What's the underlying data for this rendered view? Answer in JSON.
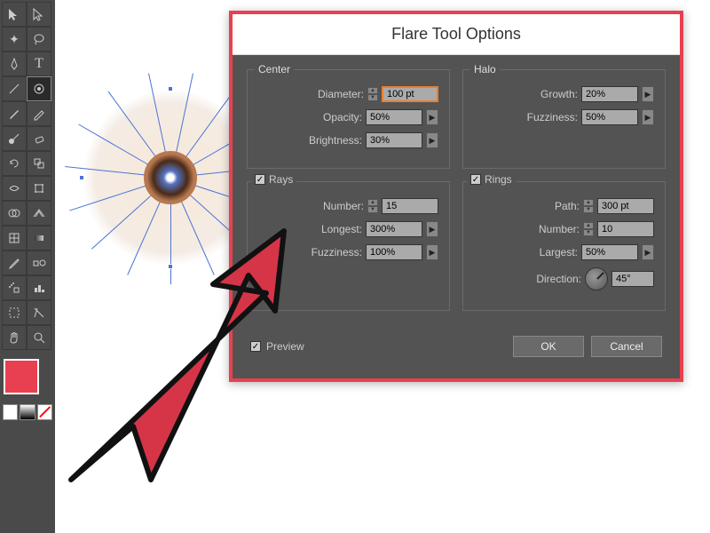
{
  "dialog": {
    "title": "Flare Tool Options",
    "center": {
      "title": "Center",
      "diameter_label": "Diameter:",
      "diameter": "100 pt",
      "opacity_label": "Opacity:",
      "opacity": "50%",
      "brightness_label": "Brightness:",
      "brightness": "30%"
    },
    "halo": {
      "title": "Halo",
      "growth_label": "Growth:",
      "growth": "20%",
      "fuzziness_label": "Fuzziness:",
      "fuzziness": "50%"
    },
    "rays": {
      "title": "Rays",
      "checked": true,
      "number_label": "Number:",
      "number": "15",
      "longest_label": "Longest:",
      "longest": "300%",
      "fuzziness_label": "Fuzziness:",
      "fuzziness": "100%"
    },
    "rings": {
      "title": "Rings",
      "checked": true,
      "path_label": "Path:",
      "path": "300 pt",
      "number_label": "Number:",
      "number": "10",
      "largest_label": "Largest:",
      "largest": "50%",
      "direction_label": "Direction:",
      "direction": "45°"
    },
    "preview_label": "Preview",
    "ok_label": "OK",
    "cancel_label": "Cancel"
  },
  "toolbar": {
    "tools": [
      [
        "selection",
        "direct-selection"
      ],
      [
        "magic-wand",
        "lasso"
      ],
      [
        "pen",
        "type"
      ],
      [
        "line-segment",
        "flare"
      ],
      [
        "paintbrush",
        "pencil"
      ],
      [
        "blob-brush",
        "eraser"
      ],
      [
        "rotate",
        "scale"
      ],
      [
        "width",
        "free-transform"
      ],
      [
        "shape-builder",
        "perspective-grid"
      ],
      [
        "mesh",
        "gradient"
      ],
      [
        "eyedropper",
        "blend"
      ],
      [
        "symbol-sprayer",
        "column-graph"
      ],
      [
        "artboard",
        "slice"
      ],
      [
        "hand",
        "zoom"
      ]
    ],
    "selected": "flare"
  },
  "colors": {
    "fill": "#e84050",
    "stroke": "#000000"
  }
}
